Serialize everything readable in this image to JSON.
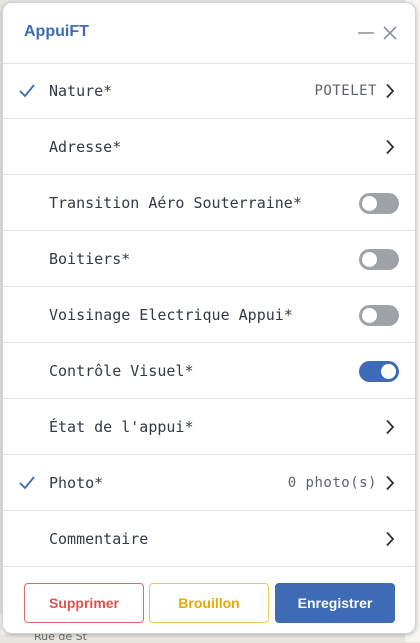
{
  "dialog": {
    "title": "AppuiFT"
  },
  "fields": [
    {
      "label": "Nature*",
      "checked": true,
      "value": "POTELET",
      "control": "chevron"
    },
    {
      "label": "Adresse*",
      "checked": false,
      "value": "",
      "control": "chevron"
    },
    {
      "label": "Transition Aéro Souterraine*",
      "checked": false,
      "control": "toggle",
      "on": false
    },
    {
      "label": "Boitiers*",
      "checked": false,
      "control": "toggle",
      "on": false
    },
    {
      "label": "Voisinage Electrique Appui*",
      "checked": false,
      "control": "toggle",
      "on": false
    },
    {
      "label": "Contrôle Visuel*",
      "checked": false,
      "control": "toggle",
      "on": true
    },
    {
      "label": "État de l'appui*",
      "checked": false,
      "value": "",
      "control": "chevron"
    },
    {
      "label": "Photo*",
      "checked": true,
      "value": "0 photo(s)",
      "control": "chevron"
    },
    {
      "label": "Commentaire",
      "checked": false,
      "value": "",
      "control": "chevron"
    }
  ],
  "buttons": {
    "delete": "Supprimer",
    "draft": "Brouillon",
    "save": "Enregistrer"
  },
  "map": {
    "street_label": "Rue de St"
  },
  "colors": {
    "accent": "#3d6bb5",
    "danger": "#d9534f",
    "warning": "#e8a900",
    "toggle_off": "#9fa3a8"
  }
}
